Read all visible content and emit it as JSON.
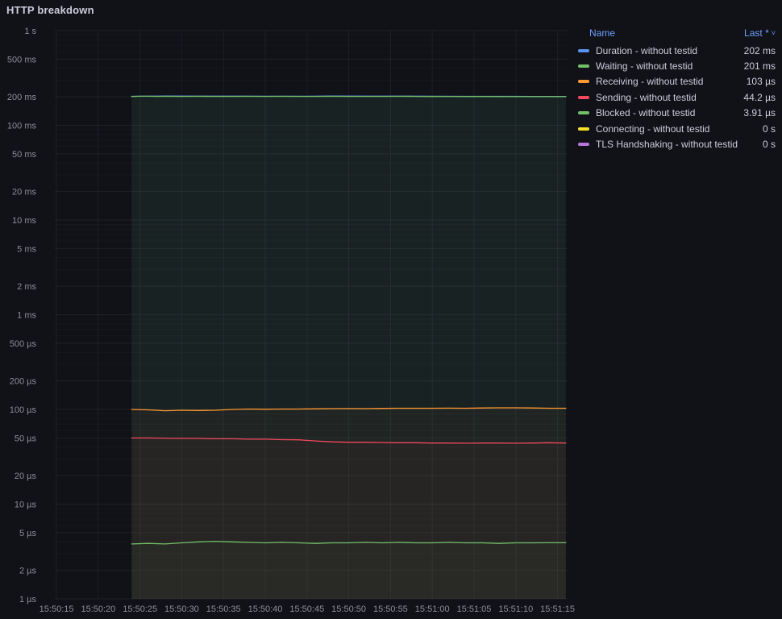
{
  "panel": {
    "title": "HTTP breakdown"
  },
  "legend": {
    "header": {
      "name": "Name",
      "value_label": "Last *",
      "sort_caret": "˅"
    }
  },
  "chart_data": {
    "type": "line",
    "title": "HTTP breakdown",
    "x_axis": {
      "ticks": [
        {
          "t": 15,
          "label": "15:50:15"
        },
        {
          "t": 20,
          "label": "15:50:20"
        },
        {
          "t": 25,
          "label": "15:50:25"
        },
        {
          "t": 30,
          "label": "15:50:30"
        },
        {
          "t": 35,
          "label": "15:50:35"
        },
        {
          "t": 40,
          "label": "15:50:40"
        },
        {
          "t": 45,
          "label": "15:50:45"
        },
        {
          "t": 50,
          "label": "15:50:50"
        },
        {
          "t": 55,
          "label": "15:50:55"
        },
        {
          "t": 60,
          "label": "15:51:00"
        },
        {
          "t": 65,
          "label": "15:51:05"
        },
        {
          "t": 70,
          "label": "15:51:10"
        },
        {
          "t": 75,
          "label": "15:51:15"
        }
      ]
    },
    "y_axis": {
      "scale": "log",
      "ticks": [
        {
          "v": 1,
          "label": "1 s"
        },
        {
          "v": 0.5,
          "label": "500 ms"
        },
        {
          "v": 0.2,
          "label": "200 ms"
        },
        {
          "v": 0.1,
          "label": "100 ms"
        },
        {
          "v": 0.05,
          "label": "50 ms"
        },
        {
          "v": 0.02,
          "label": "20 ms"
        },
        {
          "v": 0.01,
          "label": "10 ms"
        },
        {
          "v": 0.005,
          "label": "5 ms"
        },
        {
          "v": 0.002,
          "label": "2 ms"
        },
        {
          "v": 0.001,
          "label": "1 ms"
        },
        {
          "v": 0.0005,
          "label": "500 µs"
        },
        {
          "v": 0.0002,
          "label": "200 µs"
        },
        {
          "v": 0.0001,
          "label": "100 µs"
        },
        {
          "v": 5e-05,
          "label": "50 µs"
        },
        {
          "v": 2e-05,
          "label": "20 µs"
        },
        {
          "v": 1e-05,
          "label": "10 µs"
        },
        {
          "v": 5e-06,
          "label": "5 µs"
        },
        {
          "v": 2e-06,
          "label": "2 µs"
        },
        {
          "v": 1e-06,
          "label": "1 µs"
        }
      ]
    },
    "xlim": [
      14.8,
      76.2
    ],
    "ylim": [
      1e-06,
      1
    ],
    "grid": true,
    "legend_position": "right",
    "series": [
      {
        "name": "Duration - without testid",
        "color": "#5794f2",
        "last": "202 ms",
        "fill_opacity": 0.04,
        "points": [
          [
            24,
            0.2025
          ],
          [
            28,
            0.2035
          ],
          [
            32,
            0.2034
          ],
          [
            36,
            0.2032
          ],
          [
            40,
            0.203
          ],
          [
            44,
            0.203
          ],
          [
            48,
            0.2035
          ],
          [
            52,
            0.2032
          ],
          [
            56,
            0.2033
          ],
          [
            60,
            0.2028
          ],
          [
            64,
            0.2025
          ],
          [
            68,
            0.2023
          ],
          [
            72,
            0.202
          ],
          [
            76,
            0.202
          ]
        ]
      },
      {
        "name": "Waiting - without testid",
        "color": "#73bf69",
        "last": "201 ms",
        "fill_opacity": 0.07,
        "points": [
          [
            24,
            0.2015
          ],
          [
            25,
            0.203
          ],
          [
            26,
            0.2028
          ],
          [
            27,
            0.2022
          ],
          [
            28,
            0.2025
          ],
          [
            30,
            0.202
          ],
          [
            32,
            0.2024
          ],
          [
            34,
            0.202
          ],
          [
            36,
            0.2022
          ],
          [
            38,
            0.2026
          ],
          [
            40,
            0.202
          ],
          [
            42,
            0.2024
          ],
          [
            44,
            0.202
          ],
          [
            46,
            0.2022
          ],
          [
            48,
            0.2025
          ],
          [
            50,
            0.202
          ],
          [
            52,
            0.2022
          ],
          [
            54,
            0.202
          ],
          [
            56,
            0.2023
          ],
          [
            58,
            0.202
          ],
          [
            60,
            0.2018
          ],
          [
            62,
            0.202
          ],
          [
            64,
            0.2015
          ],
          [
            66,
            0.2018
          ],
          [
            68,
            0.2013
          ],
          [
            70,
            0.2015
          ],
          [
            72,
            0.201
          ],
          [
            74,
            0.2012
          ],
          [
            76,
            0.201
          ]
        ]
      },
      {
        "name": "Receiving - without testid",
        "color": "#ff9830",
        "last": "103 µs",
        "fill_opacity": 0.03,
        "points": [
          [
            24,
            0.0001
          ],
          [
            26,
            9.9e-05
          ],
          [
            28,
            9.7e-05
          ],
          [
            30,
            9.8e-05
          ],
          [
            32,
            9.75e-05
          ],
          [
            34,
            9.8e-05
          ],
          [
            36,
            0.0001
          ],
          [
            38,
            0.000101
          ],
          [
            40,
            0.0001005
          ],
          [
            42,
            0.000101
          ],
          [
            44,
            0.000101
          ],
          [
            46,
            0.0001015
          ],
          [
            48,
            0.000102
          ],
          [
            50,
            0.0001022
          ],
          [
            52,
            0.000102
          ],
          [
            54,
            0.0001025
          ],
          [
            56,
            0.000103
          ],
          [
            58,
            0.000103
          ],
          [
            60,
            0.000103
          ],
          [
            62,
            0.0001032
          ],
          [
            64,
            0.000103
          ],
          [
            66,
            0.0001035
          ],
          [
            68,
            0.000104
          ],
          [
            70,
            0.000104
          ],
          [
            72,
            0.0001035
          ],
          [
            74,
            0.000103
          ],
          [
            76,
            0.000103
          ]
        ]
      },
      {
        "name": "Sending - without testid",
        "color": "#f2495c",
        "last": "44.2 µs",
        "fill_opacity": 0.03,
        "points": [
          [
            24,
            5e-05
          ],
          [
            26,
            5e-05
          ],
          [
            28,
            4.98e-05
          ],
          [
            30,
            4.95e-05
          ],
          [
            32,
            4.95e-05
          ],
          [
            34,
            4.9e-05
          ],
          [
            36,
            4.9e-05
          ],
          [
            38,
            4.85e-05
          ],
          [
            40,
            4.85e-05
          ],
          [
            42,
            4.8e-05
          ],
          [
            44,
            4.78e-05
          ],
          [
            46,
            4.65e-05
          ],
          [
            48,
            4.55e-05
          ],
          [
            50,
            4.5e-05
          ],
          [
            52,
            4.5e-05
          ],
          [
            54,
            4.48e-05
          ],
          [
            56,
            4.45e-05
          ],
          [
            58,
            4.45e-05
          ],
          [
            60,
            4.42e-05
          ],
          [
            62,
            4.42e-05
          ],
          [
            64,
            4.4e-05
          ],
          [
            66,
            4.42e-05
          ],
          [
            68,
            4.42e-05
          ],
          [
            70,
            4.4e-05
          ],
          [
            72,
            4.42e-05
          ],
          [
            74,
            4.45e-05
          ],
          [
            76,
            4.42e-05
          ]
        ]
      },
      {
        "name": "Blocked - without testid",
        "color": "#73bf69",
        "last": "3.91 µs",
        "fill_opacity": 0.03,
        "points": [
          [
            24,
            3.8e-06
          ],
          [
            26,
            3.85e-06
          ],
          [
            28,
            3.8e-06
          ],
          [
            30,
            3.9e-06
          ],
          [
            32,
            4e-06
          ],
          [
            34,
            4.05e-06
          ],
          [
            36,
            4e-06
          ],
          [
            38,
            3.95e-06
          ],
          [
            40,
            3.9e-06
          ],
          [
            42,
            3.95e-06
          ],
          [
            44,
            3.9e-06
          ],
          [
            46,
            3.85e-06
          ],
          [
            48,
            3.9e-06
          ],
          [
            50,
            3.9e-06
          ],
          [
            52,
            3.95e-06
          ],
          [
            54,
            3.9e-06
          ],
          [
            56,
            3.95e-06
          ],
          [
            58,
            3.9e-06
          ],
          [
            60,
            3.9e-06
          ],
          [
            62,
            3.95e-06
          ],
          [
            64,
            3.9e-06
          ],
          [
            66,
            3.9e-06
          ],
          [
            68,
            3.85e-06
          ],
          [
            70,
            3.9e-06
          ],
          [
            72,
            3.9e-06
          ],
          [
            74,
            3.91e-06
          ],
          [
            76,
            3.91e-06
          ]
        ]
      },
      {
        "name": "Connecting - without testid",
        "color": "#fade2a",
        "last": "0 s",
        "fill_opacity": 0,
        "points": []
      },
      {
        "name": "TLS Handshaking - without testid",
        "color": "#b877d9",
        "last": "0 s",
        "fill_opacity": 0,
        "points": []
      }
    ]
  }
}
